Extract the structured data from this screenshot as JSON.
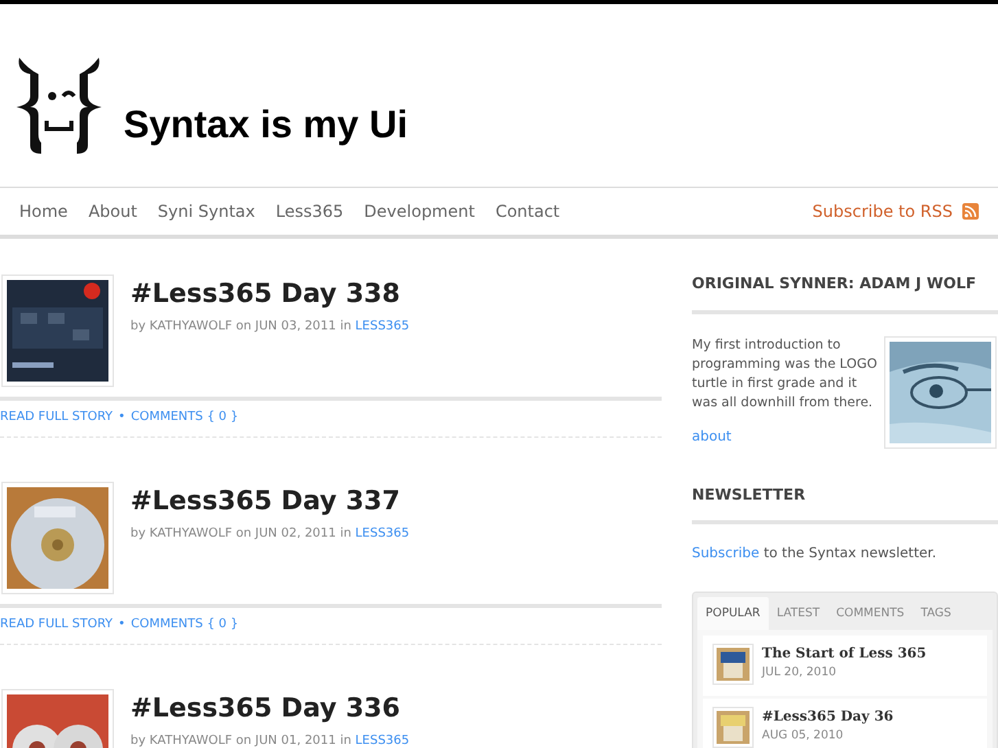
{
  "site": {
    "title": "Syntax is my Ui"
  },
  "nav": {
    "items": [
      {
        "label": "Home"
      },
      {
        "label": "About"
      },
      {
        "label": "Syni Syntax"
      },
      {
        "label": "Less365"
      },
      {
        "label": "Development"
      },
      {
        "label": "Contact"
      }
    ],
    "rss": "Subscribe to RSS"
  },
  "posts": [
    {
      "title": "#Less365 Day 338",
      "meta": "by KATHYAWOLF on JUN 03, 2011 in",
      "category": "LESS365",
      "read_more": "READ FULL STORY",
      "separator": "•",
      "comments": "COMMENTS { 0 }"
    },
    {
      "title": "#Less365 Day 337",
      "meta": "by KATHYAWOLF on JUN 02, 2011 in",
      "category": "LESS365",
      "read_more": "READ FULL STORY",
      "separator": "•",
      "comments": "COMMENTS { 0 }"
    },
    {
      "title": "#Less365 Day 336",
      "meta": "by KATHYAWOLF on JUN 01, 2011 in",
      "category": "LESS365"
    }
  ],
  "sidebar": {
    "author": {
      "heading": "ORIGINAL SYNNER: ADAM J WOLF",
      "bio": "My first introduction to programming was the LOGO turtle in first grade and it was all downhill from there.",
      "link": "about"
    },
    "newsletter": {
      "heading": "NEWSLETTER",
      "link": "Subscribe",
      "rest": " to the Syntax newsletter."
    },
    "tabs": [
      {
        "label": "POPULAR",
        "selected": true
      },
      {
        "label": "LATEST",
        "selected": false
      },
      {
        "label": "COMMENTS",
        "selected": false
      },
      {
        "label": "TAGS",
        "selected": false
      }
    ],
    "popular": [
      {
        "title": "The Start of Less 365",
        "date": "JUL 20, 2010"
      },
      {
        "title": "#Less365 Day 36",
        "date": "AUG 05, 2010"
      }
    ]
  }
}
